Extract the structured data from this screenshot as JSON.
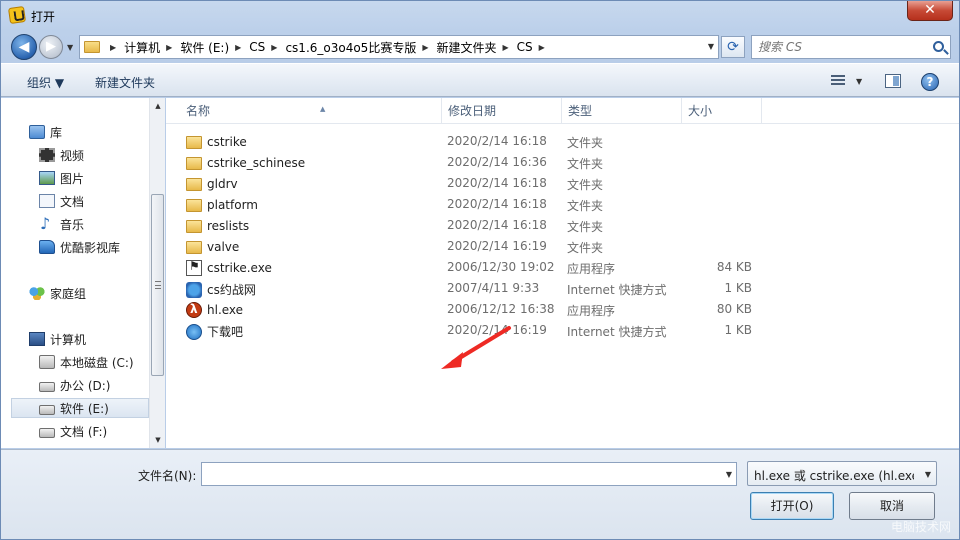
{
  "window": {
    "title": "打开",
    "close_label": "✕"
  },
  "nav": {
    "back_label": "◀",
    "forward_label": "▶",
    "breadcrumbs": [
      "计算机",
      "软件 (E:)",
      "CS",
      "cs1.6_o3o4o5比赛专版",
      "新建文件夹",
      "CS"
    ],
    "search_placeholder": "搜索 CS"
  },
  "toolbar": {
    "organize_label": "组织 ▼",
    "new_folder_label": "新建文件夹",
    "help_label": "?"
  },
  "sidebar": {
    "library": {
      "label": "库",
      "items": [
        {
          "label": "视频",
          "icon": "video-icon"
        },
        {
          "label": "图片",
          "icon": "picture-icon"
        },
        {
          "label": "文档",
          "icon": "document-icon"
        },
        {
          "label": "音乐",
          "icon": "music-icon"
        },
        {
          "label": "优酷影视库",
          "icon": "youku-library-icon"
        }
      ]
    },
    "homegroup": {
      "label": "家庭组"
    },
    "computer": {
      "label": "计算机",
      "drives": [
        {
          "label": "本地磁盘 (C:)"
        },
        {
          "label": "办公 (D:)"
        },
        {
          "label": "软件 (E:)",
          "selected": true
        },
        {
          "label": "文档 (F:)"
        }
      ]
    }
  },
  "columns": {
    "name": "名称",
    "date": "修改日期",
    "type": "类型",
    "size": "大小"
  },
  "files": [
    {
      "name": "cstrike",
      "date": "2020/2/14 16:18",
      "type": "文件夹",
      "size": "",
      "icon": "folder"
    },
    {
      "name": "cstrike_schinese",
      "date": "2020/2/14 16:36",
      "type": "文件夹",
      "size": "",
      "icon": "folder"
    },
    {
      "name": "gldrv",
      "date": "2020/2/14 16:18",
      "type": "文件夹",
      "size": "",
      "icon": "folder"
    },
    {
      "name": "platform",
      "date": "2020/2/14 16:18",
      "type": "文件夹",
      "size": "",
      "icon": "folder"
    },
    {
      "name": "reslists",
      "date": "2020/2/14 16:18",
      "type": "文件夹",
      "size": "",
      "icon": "folder"
    },
    {
      "name": "valve",
      "date": "2020/2/14 16:19",
      "type": "文件夹",
      "size": "",
      "icon": "folder"
    },
    {
      "name": "cstrike.exe",
      "date": "2006/12/30 19:02",
      "type": "应用程序",
      "size": "84 KB",
      "icon": "cs"
    },
    {
      "name": "cs约战网",
      "date": "2007/4/11 9:33",
      "type": "Internet 快捷方式",
      "size": "1 KB",
      "icon": "web"
    },
    {
      "name": "hl.exe",
      "date": "2006/12/12 16:38",
      "type": "应用程序",
      "size": "80 KB",
      "icon": "hl"
    },
    {
      "name": "下载吧",
      "date": "2020/2/14 16:19",
      "type": "Internet 快捷方式",
      "size": "1 KB",
      "icon": "xzb"
    }
  ],
  "footer": {
    "filename_label": "文件名(N):",
    "filename_value": "",
    "filter_value": "hl.exe 或 cstrike.exe (hl.exe;c",
    "open_label": "打开(O)",
    "cancel_label": "取消"
  },
  "watermark": "电脑技术网"
}
